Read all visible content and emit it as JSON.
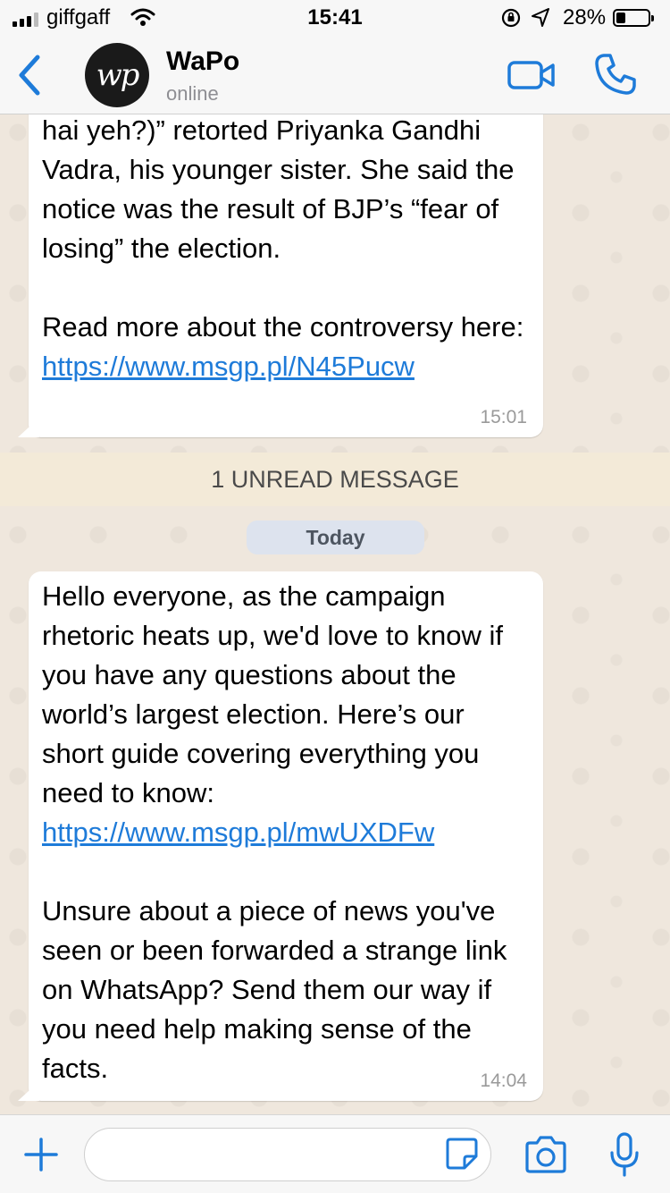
{
  "status_bar": {
    "carrier": "giffgaff",
    "time": "15:41",
    "battery_percent": "28%",
    "battery_level": 0.28
  },
  "header": {
    "avatar_text": "wp",
    "name": "WaPo",
    "status": "online"
  },
  "messages": [
    {
      "paragraphs": [
        "hai yeh?)” retorted Priyanka Gandhi Vadra, his younger sister. She said the notice was the result of BJP’s “fear of losing” the election."
      ],
      "link_prefix": "Read more about the controversy here: ",
      "link": "https://www.msgp.pl/N45Pucw",
      "time": "15:01"
    },
    {
      "intro": "Hello everyone, as the campaign rhetoric heats up, we'd love to know if you have any questions about the world’s largest election. Here’s our short guide covering everything you need to know:",
      "link": "https://www.msgp.pl/mwUXDFw",
      "outro": "Unsure about a piece of news you've seen or been forwarded a strange link on WhatsApp? Send them our way if you need help making sense of the facts.",
      "time": "14:04"
    }
  ],
  "unread_banner": "1 UNREAD MESSAGE",
  "date_chip": "Today",
  "input": {
    "value": "",
    "placeholder": ""
  },
  "colors": {
    "accent": "#1e7bd9",
    "chat_background": "#efe7dd",
    "bubble": "#ffffff",
    "unread_banner": "#f3ead8"
  }
}
